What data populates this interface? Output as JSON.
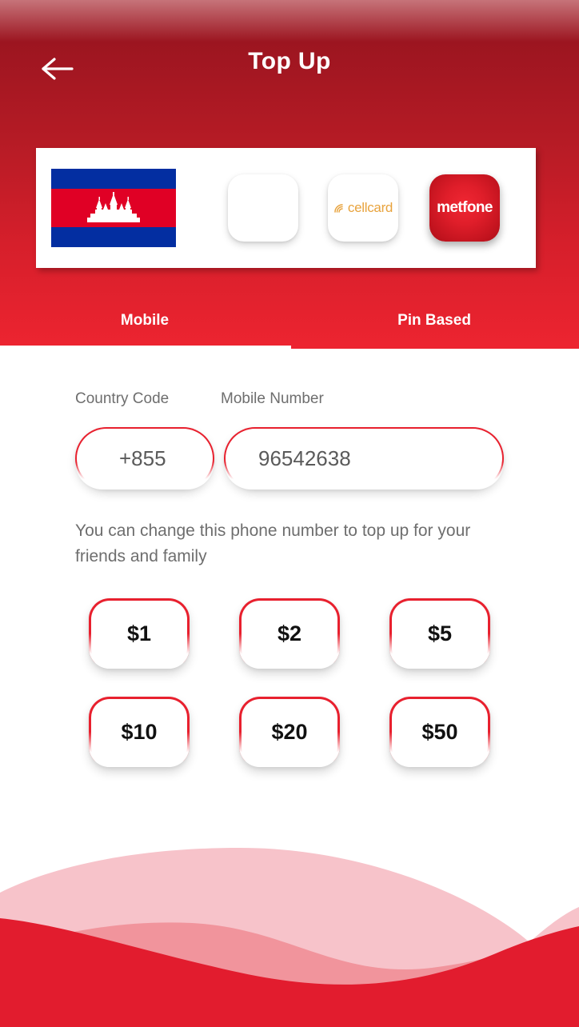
{
  "header": {
    "title": "Top Up",
    "back_icon": "arrow-left-icon",
    "gradient_from": "#8C1520",
    "gradient_to": "#ED2430"
  },
  "operators": {
    "items": [
      {
        "id": "country-flag",
        "type": "flag",
        "name": "Cambodia",
        "icon": "cambodia-flag-icon",
        "label": ""
      },
      {
        "id": "operator-blank",
        "type": "placeholder",
        "name": "",
        "icon": "blank-card-icon",
        "label": ""
      },
      {
        "id": "operator-cellcard",
        "type": "logo",
        "name": "Cellcard",
        "icon": "cellcard-logo-icon",
        "label": "cellcard",
        "color": "#E8A33D"
      },
      {
        "id": "operator-metfone",
        "type": "logo",
        "name": "Metfone",
        "icon": "metfone-logo-icon",
        "label": "metfone",
        "color": "#E01E2A"
      }
    ]
  },
  "tabs": {
    "items": [
      {
        "label": "Mobile",
        "active": true
      },
      {
        "label": "Pin Based",
        "active": false
      }
    ]
  },
  "form": {
    "country_code_label": "Country Code",
    "country_code_value": "+855",
    "mobile_number_label": "Mobile Number",
    "mobile_number_value": "96542638",
    "mobile_number_placeholder": "Mobile Number",
    "helper_text": "You can change this phone number to top up for your friends and family"
  },
  "amounts": {
    "rows": [
      [
        {
          "label": "$1"
        },
        {
          "label": "$2"
        },
        {
          "label": "$5"
        }
      ],
      [
        {
          "label": "$10"
        },
        {
          "label": "$20"
        },
        {
          "label": "$50"
        }
      ]
    ]
  },
  "decoration": {
    "wave_light": "#F7C3CA",
    "wave_mid": "#F08790",
    "wave_base": "#E21C2E"
  }
}
